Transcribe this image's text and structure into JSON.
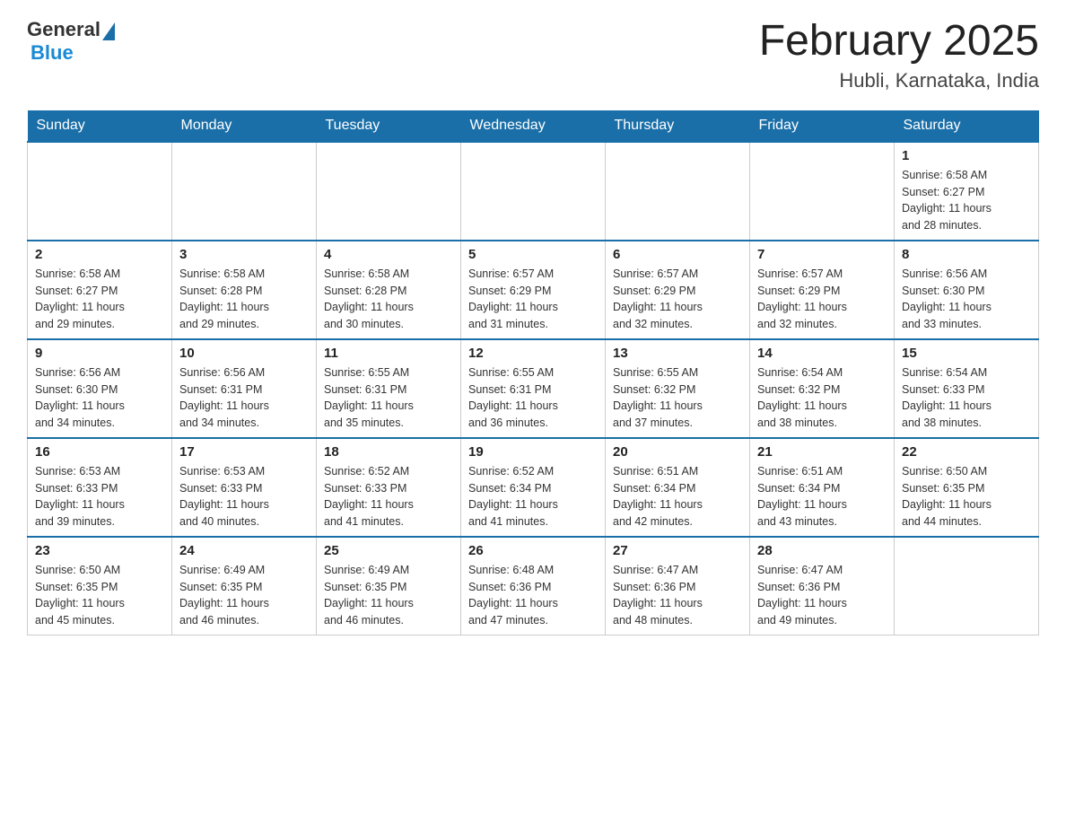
{
  "header": {
    "logo_general": "General",
    "logo_blue": "Blue",
    "month_year": "February 2025",
    "location": "Hubli, Karnataka, India"
  },
  "days_of_week": [
    "Sunday",
    "Monday",
    "Tuesday",
    "Wednesday",
    "Thursday",
    "Friday",
    "Saturday"
  ],
  "weeks": [
    [
      {
        "day": "",
        "info": ""
      },
      {
        "day": "",
        "info": ""
      },
      {
        "day": "",
        "info": ""
      },
      {
        "day": "",
        "info": ""
      },
      {
        "day": "",
        "info": ""
      },
      {
        "day": "",
        "info": ""
      },
      {
        "day": "1",
        "info": "Sunrise: 6:58 AM\nSunset: 6:27 PM\nDaylight: 11 hours\nand 28 minutes."
      }
    ],
    [
      {
        "day": "2",
        "info": "Sunrise: 6:58 AM\nSunset: 6:27 PM\nDaylight: 11 hours\nand 29 minutes."
      },
      {
        "day": "3",
        "info": "Sunrise: 6:58 AM\nSunset: 6:28 PM\nDaylight: 11 hours\nand 29 minutes."
      },
      {
        "day": "4",
        "info": "Sunrise: 6:58 AM\nSunset: 6:28 PM\nDaylight: 11 hours\nand 30 minutes."
      },
      {
        "day": "5",
        "info": "Sunrise: 6:57 AM\nSunset: 6:29 PM\nDaylight: 11 hours\nand 31 minutes."
      },
      {
        "day": "6",
        "info": "Sunrise: 6:57 AM\nSunset: 6:29 PM\nDaylight: 11 hours\nand 32 minutes."
      },
      {
        "day": "7",
        "info": "Sunrise: 6:57 AM\nSunset: 6:29 PM\nDaylight: 11 hours\nand 32 minutes."
      },
      {
        "day": "8",
        "info": "Sunrise: 6:56 AM\nSunset: 6:30 PM\nDaylight: 11 hours\nand 33 minutes."
      }
    ],
    [
      {
        "day": "9",
        "info": "Sunrise: 6:56 AM\nSunset: 6:30 PM\nDaylight: 11 hours\nand 34 minutes."
      },
      {
        "day": "10",
        "info": "Sunrise: 6:56 AM\nSunset: 6:31 PM\nDaylight: 11 hours\nand 34 minutes."
      },
      {
        "day": "11",
        "info": "Sunrise: 6:55 AM\nSunset: 6:31 PM\nDaylight: 11 hours\nand 35 minutes."
      },
      {
        "day": "12",
        "info": "Sunrise: 6:55 AM\nSunset: 6:31 PM\nDaylight: 11 hours\nand 36 minutes."
      },
      {
        "day": "13",
        "info": "Sunrise: 6:55 AM\nSunset: 6:32 PM\nDaylight: 11 hours\nand 37 minutes."
      },
      {
        "day": "14",
        "info": "Sunrise: 6:54 AM\nSunset: 6:32 PM\nDaylight: 11 hours\nand 38 minutes."
      },
      {
        "day": "15",
        "info": "Sunrise: 6:54 AM\nSunset: 6:33 PM\nDaylight: 11 hours\nand 38 minutes."
      }
    ],
    [
      {
        "day": "16",
        "info": "Sunrise: 6:53 AM\nSunset: 6:33 PM\nDaylight: 11 hours\nand 39 minutes."
      },
      {
        "day": "17",
        "info": "Sunrise: 6:53 AM\nSunset: 6:33 PM\nDaylight: 11 hours\nand 40 minutes."
      },
      {
        "day": "18",
        "info": "Sunrise: 6:52 AM\nSunset: 6:33 PM\nDaylight: 11 hours\nand 41 minutes."
      },
      {
        "day": "19",
        "info": "Sunrise: 6:52 AM\nSunset: 6:34 PM\nDaylight: 11 hours\nand 41 minutes."
      },
      {
        "day": "20",
        "info": "Sunrise: 6:51 AM\nSunset: 6:34 PM\nDaylight: 11 hours\nand 42 minutes."
      },
      {
        "day": "21",
        "info": "Sunrise: 6:51 AM\nSunset: 6:34 PM\nDaylight: 11 hours\nand 43 minutes."
      },
      {
        "day": "22",
        "info": "Sunrise: 6:50 AM\nSunset: 6:35 PM\nDaylight: 11 hours\nand 44 minutes."
      }
    ],
    [
      {
        "day": "23",
        "info": "Sunrise: 6:50 AM\nSunset: 6:35 PM\nDaylight: 11 hours\nand 45 minutes."
      },
      {
        "day": "24",
        "info": "Sunrise: 6:49 AM\nSunset: 6:35 PM\nDaylight: 11 hours\nand 46 minutes."
      },
      {
        "day": "25",
        "info": "Sunrise: 6:49 AM\nSunset: 6:35 PM\nDaylight: 11 hours\nand 46 minutes."
      },
      {
        "day": "26",
        "info": "Sunrise: 6:48 AM\nSunset: 6:36 PM\nDaylight: 11 hours\nand 47 minutes."
      },
      {
        "day": "27",
        "info": "Sunrise: 6:47 AM\nSunset: 6:36 PM\nDaylight: 11 hours\nand 48 minutes."
      },
      {
        "day": "28",
        "info": "Sunrise: 6:47 AM\nSunset: 6:36 PM\nDaylight: 11 hours\nand 49 minutes."
      },
      {
        "day": "",
        "info": ""
      }
    ]
  ]
}
